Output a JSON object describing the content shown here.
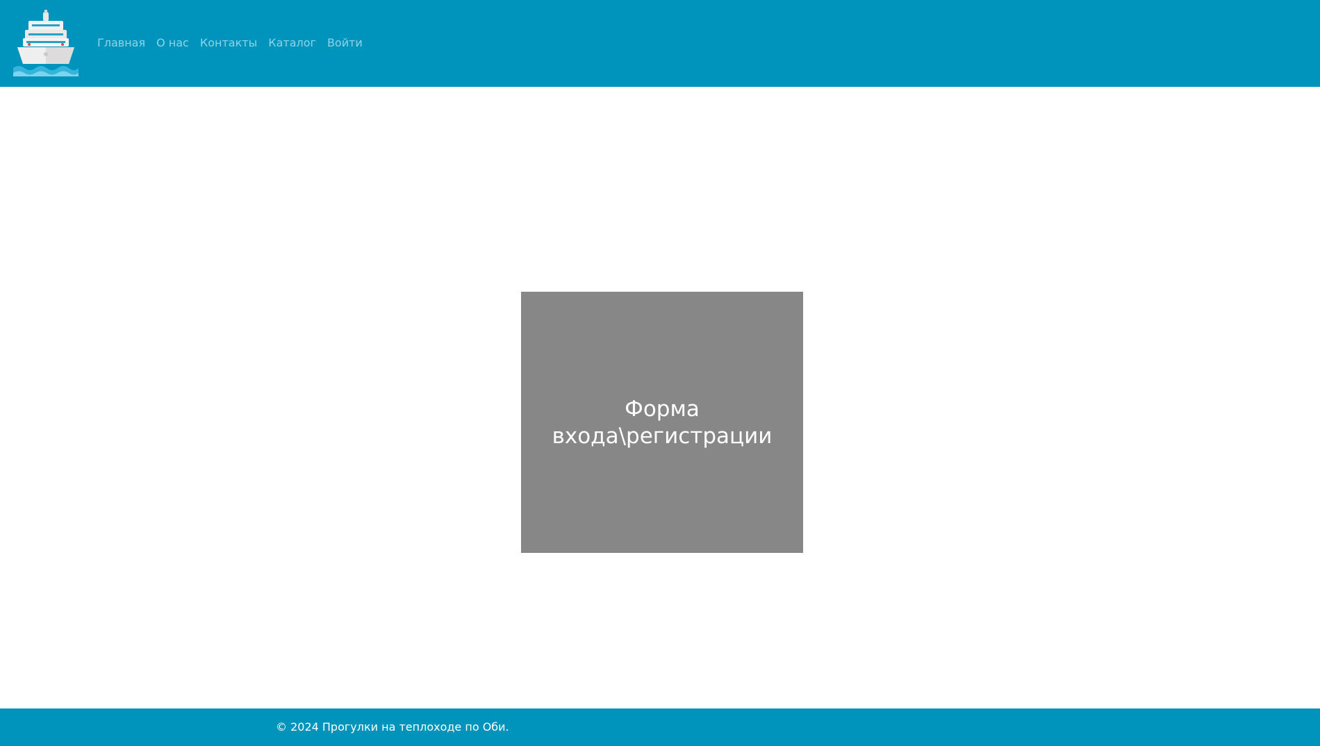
{
  "header": {
    "logo_icon": "ship-icon",
    "nav": [
      {
        "label": "Главная"
      },
      {
        "label": "О нас"
      },
      {
        "label": "Контакты"
      },
      {
        "label": "Каталог"
      },
      {
        "label": "Войти"
      }
    ]
  },
  "main": {
    "placeholder_line1": "Форма",
    "placeholder_line2": "входа\\регистрации"
  },
  "footer": {
    "copyright": "© 2024 Прогулки на теплоходе по Оби."
  },
  "colors": {
    "brand": "#0093bb",
    "nav_link": "#8cd6ea",
    "placeholder_bg": "#878787"
  }
}
